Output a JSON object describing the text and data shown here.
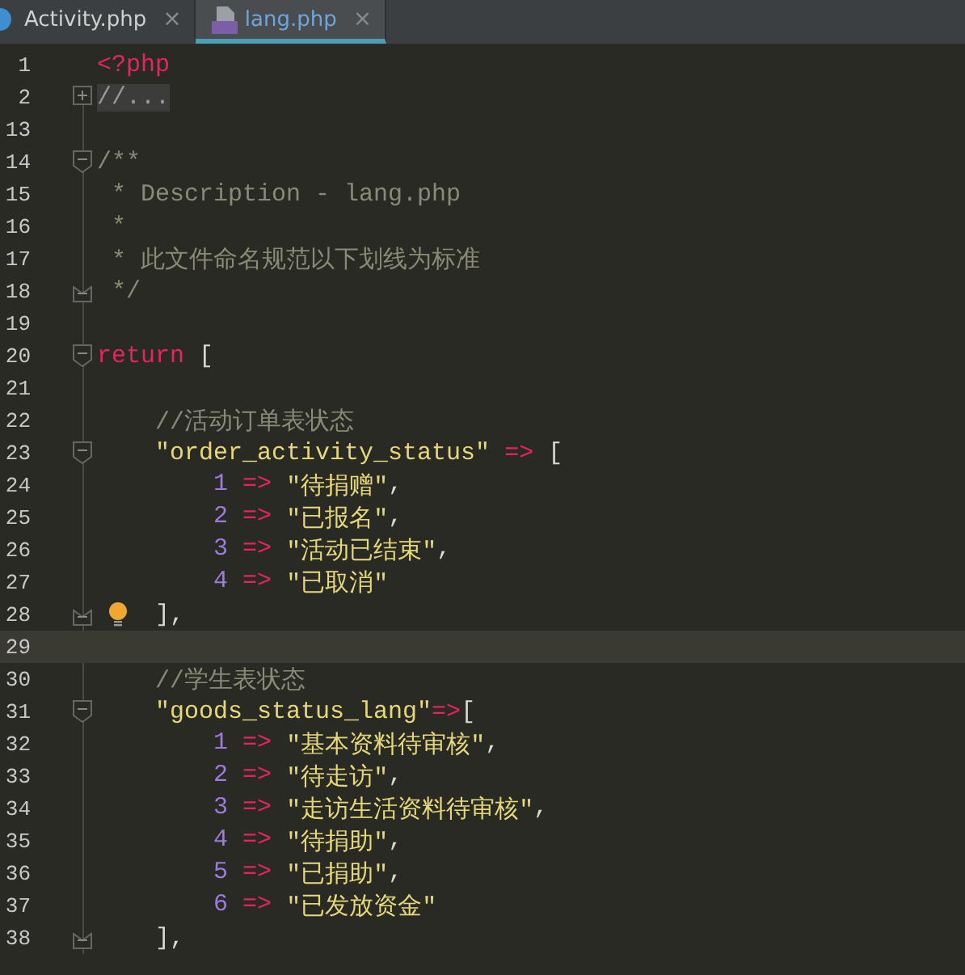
{
  "tabs": [
    {
      "label": "Activity.php",
      "selected": false,
      "close": "×"
    },
    {
      "label": "lang.php",
      "selected": true,
      "close": "×"
    }
  ],
  "lines": [
    {
      "number": "1",
      "tokens": [
        {
          "kind": "keyword",
          "text": "<?php"
        }
      ]
    },
    {
      "number": "2",
      "fold": {
        "kind": "expand"
      },
      "tokens": [
        {
          "kind": "folded",
          "text": "//..."
        }
      ]
    },
    {
      "number": "13"
    },
    {
      "number": "14",
      "fold": {
        "kind": "start"
      },
      "tokens": [
        {
          "kind": "comment",
          "text": "/**"
        }
      ]
    },
    {
      "number": "15",
      "tokens": [
        {
          "kind": "comment",
          "text": " * Description - lang.php"
        }
      ]
    },
    {
      "number": "16",
      "tokens": [
        {
          "kind": "comment",
          "text": " *"
        }
      ]
    },
    {
      "number": "17",
      "tokens": [
        {
          "kind": "comment",
          "text": " * 此文件命名规范以下划线为标准"
        }
      ]
    },
    {
      "number": "18",
      "fold": {
        "kind": "end"
      },
      "tokens": [
        {
          "kind": "comment",
          "text": " */"
        }
      ]
    },
    {
      "number": "19"
    },
    {
      "number": "20",
      "fold": {
        "kind": "start"
      },
      "tokens": [
        {
          "kind": "keyword",
          "text": "return"
        },
        {
          "kind": "plain",
          "text": " ["
        }
      ]
    },
    {
      "number": "21"
    },
    {
      "number": "22",
      "tokens": [
        {
          "kind": "comment",
          "text": "    //活动订单表状态"
        }
      ]
    },
    {
      "number": "23",
      "fold": {
        "kind": "start"
      },
      "tokens": [
        {
          "kind": "string",
          "text": "    \"order_activity_status\""
        },
        {
          "kind": "operator",
          "text": " =>"
        },
        {
          "kind": "plain",
          "text": " ["
        }
      ]
    },
    {
      "number": "24",
      "tokens": [
        {
          "kind": "number",
          "text": "        1"
        },
        {
          "kind": "operator",
          "text": " =>"
        },
        {
          "kind": "string",
          "text": " \"待捐赠\""
        },
        {
          "kind": "plain",
          "text": ","
        }
      ]
    },
    {
      "number": "25",
      "tokens": [
        {
          "kind": "number",
          "text": "        2"
        },
        {
          "kind": "operator",
          "text": " =>"
        },
        {
          "kind": "string",
          "text": " \"已报名\""
        },
        {
          "kind": "plain",
          "text": ","
        }
      ]
    },
    {
      "number": "26",
      "tokens": [
        {
          "kind": "number",
          "text": "        3"
        },
        {
          "kind": "operator",
          "text": " =>"
        },
        {
          "kind": "string",
          "text": " \"活动已结束\""
        },
        {
          "kind": "plain",
          "text": ","
        }
      ]
    },
    {
      "number": "27",
      "tokens": [
        {
          "kind": "number",
          "text": "        4"
        },
        {
          "kind": "operator",
          "text": " =>"
        },
        {
          "kind": "string",
          "text": " \"已取消\""
        }
      ]
    },
    {
      "number": "28",
      "fold": {
        "kind": "end"
      },
      "bulb": true,
      "tokens": [
        {
          "kind": "plain",
          "text": "    ],"
        }
      ]
    },
    {
      "number": "29",
      "current": true
    },
    {
      "number": "30",
      "tokens": [
        {
          "kind": "comment",
          "text": "    //学生表状态"
        }
      ]
    },
    {
      "number": "31",
      "fold": {
        "kind": "start"
      },
      "tokens": [
        {
          "kind": "string",
          "text": "    \"goods_status_lang\""
        },
        {
          "kind": "operator",
          "text": "=>"
        },
        {
          "kind": "plain",
          "text": "["
        }
      ]
    },
    {
      "number": "32",
      "tokens": [
        {
          "kind": "number",
          "text": "        1"
        },
        {
          "kind": "operator",
          "text": " =>"
        },
        {
          "kind": "string",
          "text": " \"基本资料待审核\""
        },
        {
          "kind": "plain",
          "text": ","
        }
      ]
    },
    {
      "number": "33",
      "tokens": [
        {
          "kind": "number",
          "text": "        2"
        },
        {
          "kind": "operator",
          "text": " =>"
        },
        {
          "kind": "string",
          "text": " \"待走访\""
        },
        {
          "kind": "plain",
          "text": ","
        }
      ]
    },
    {
      "number": "34",
      "tokens": [
        {
          "kind": "number",
          "text": "        3"
        },
        {
          "kind": "operator",
          "text": " =>"
        },
        {
          "kind": "string",
          "text": " \"走访生活资料待审核\""
        },
        {
          "kind": "plain",
          "text": ","
        }
      ]
    },
    {
      "number": "35",
      "tokens": [
        {
          "kind": "number",
          "text": "        4"
        },
        {
          "kind": "operator",
          "text": " =>"
        },
        {
          "kind": "string",
          "text": " \"待捐助\""
        },
        {
          "kind": "plain",
          "text": ","
        }
      ]
    },
    {
      "number": "36",
      "tokens": [
        {
          "kind": "number",
          "text": "        5"
        },
        {
          "kind": "operator",
          "text": " =>"
        },
        {
          "kind": "string",
          "text": " \"已捐助\""
        },
        {
          "kind": "plain",
          "text": ","
        }
      ]
    },
    {
      "number": "37",
      "tokens": [
        {
          "kind": "number",
          "text": "        6"
        },
        {
          "kind": "operator",
          "text": " =>"
        },
        {
          "kind": "string",
          "text": " \"已发放资金\""
        }
      ]
    },
    {
      "number": "38",
      "fold": {
        "kind": "end"
      },
      "tokens": [
        {
          "kind": "plain",
          "text": "    ],"
        }
      ]
    }
  ]
}
